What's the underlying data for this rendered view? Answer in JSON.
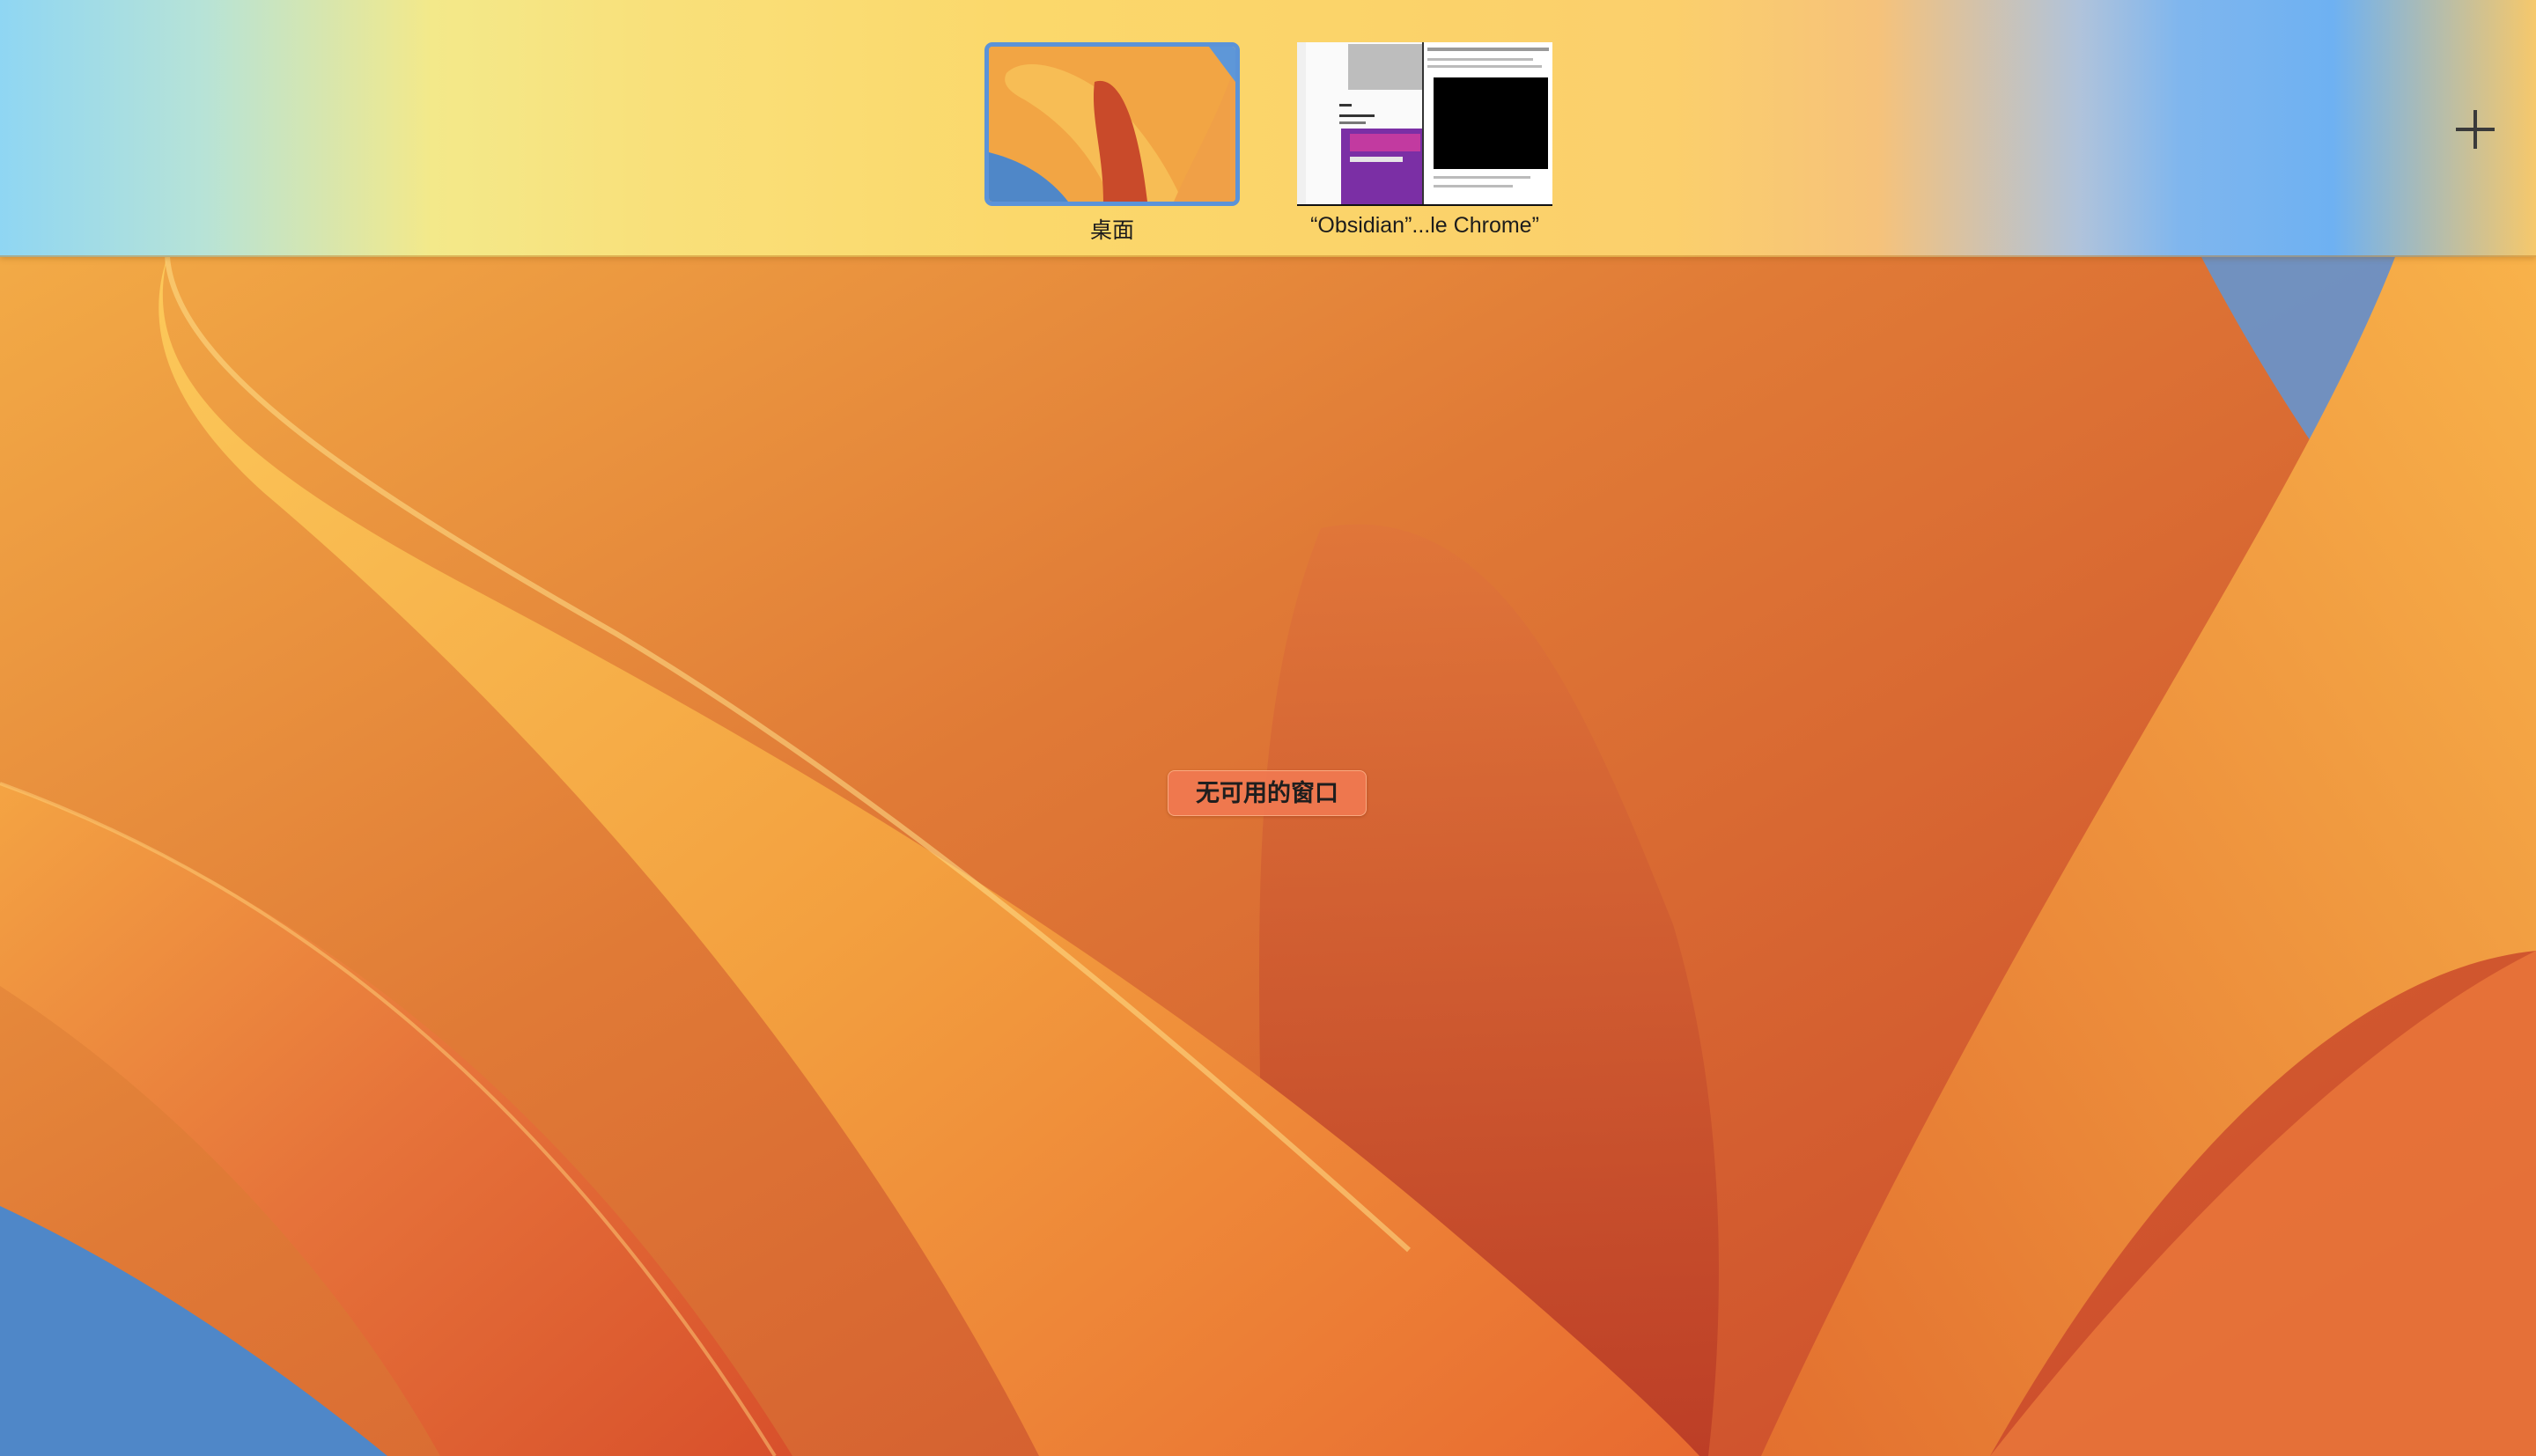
{
  "mission_control": {
    "spaces": [
      {
        "label": "桌面",
        "selected": true
      },
      {
        "label": "“Obsidian”...le Chrome”",
        "selected": false
      }
    ],
    "add_space_icon": "plus-icon",
    "empty_message": "无可用的窗口"
  },
  "colors": {
    "selection_border": "#5b93d8",
    "empty_badge": "#f07850"
  }
}
